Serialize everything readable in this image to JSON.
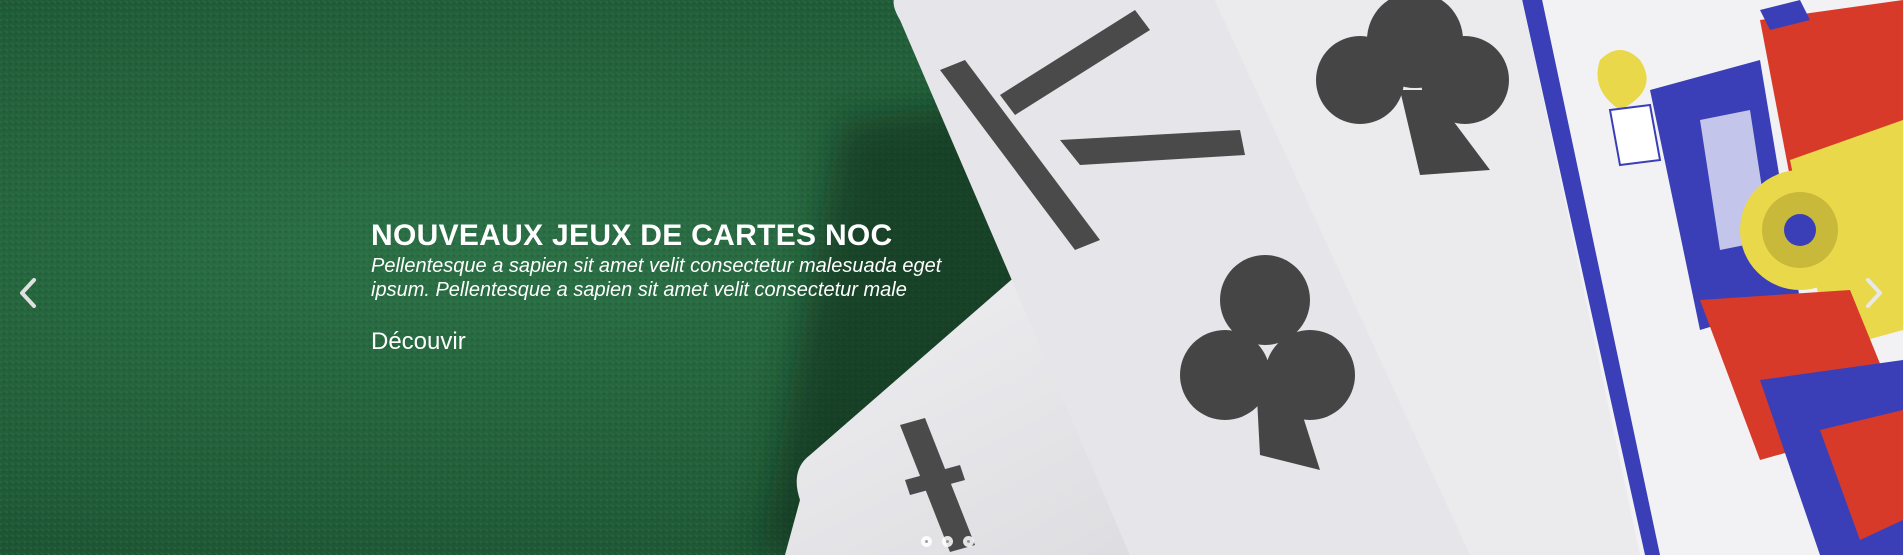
{
  "slider": {
    "slide": {
      "title": "NOUVEAUX JEUX DE CARTES NOC",
      "description": "Pellentesque a sapien sit amet velit consectetur malesuada  eget ipsum. Pellentesque a sapien sit amet velit consectetur male",
      "cta_label": "Découvir"
    },
    "prev_icon": "chevron-left-icon",
    "next_icon": "chevron-right-icon",
    "dots_count": 3,
    "colors": {
      "felt": "#1f5a36",
      "card": "#e9e9ec",
      "ink": "#4a4a4a",
      "court_blue": "#3a3fb8",
      "court_red": "#d83a2a",
      "court_yellow": "#e8d84a"
    }
  }
}
